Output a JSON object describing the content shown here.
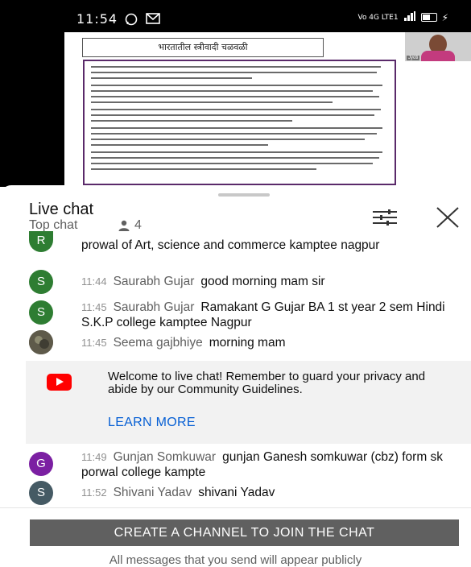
{
  "status_bar": {
    "time": "11:54",
    "left_icons": [
      "whatsapp-icon",
      "gmail-icon"
    ],
    "right_text": "Vo 4G LTE1",
    "right_icons": [
      "signal-icon",
      "battery-icon",
      "charging-icon"
    ]
  },
  "video": {
    "slide_title": "भारतातील स्त्रीवादी चळवळी",
    "participant_name": "Jyoti",
    "watermark": "zoom"
  },
  "chat": {
    "title": "Live chat",
    "mode": "Top chat",
    "viewer_count": "4",
    "icons": {
      "filter": "filter-icon",
      "close": "close-icon",
      "viewers": "person-icon"
    }
  },
  "messages": [
    {
      "avatar_letter": "R",
      "avatar_color": "#2e7d32",
      "time": "",
      "author": "",
      "text": "prowal of Art, science and commerce kamptee nagpur"
    },
    {
      "avatar_letter": "S",
      "avatar_color": "#2e7d32",
      "time": "11:44",
      "author": "Saurabh Gujar",
      "text": "good morning mam sir"
    },
    {
      "avatar_letter": "S",
      "avatar_color": "#2e7d32",
      "time": "11:45",
      "author": "Saurabh Gujar",
      "text": "Ramakant G Gujar BA 1 st year 2 sem Hindi S.K.P college kamptee Nagpur"
    },
    {
      "avatar_letter": "",
      "avatar_color": "#6b6b5a",
      "time": "11:45",
      "author": "Seema gajbhiye",
      "text": "morning mam"
    },
    {
      "avatar_letter": "G",
      "avatar_color": "#7b1fa2",
      "time": "11:49",
      "author": "Gunjan Somkuwar",
      "text": "gunjan Ganesh somkuwar (cbz) form sk porwal college kampte"
    },
    {
      "avatar_letter": "S",
      "avatar_color": "#455a64",
      "time": "11:52",
      "author": "Shivani Yadav",
      "text": "shivani Yadav"
    }
  ],
  "welcome": {
    "text": "Welcome to live chat! Remember to guard your privacy and abide by our Community Guidelines.",
    "link": "LEARN MORE"
  },
  "footer": {
    "button": "CREATE A CHANNEL TO JOIN THE CHAT",
    "note": "All messages that you send will appear publicly"
  }
}
